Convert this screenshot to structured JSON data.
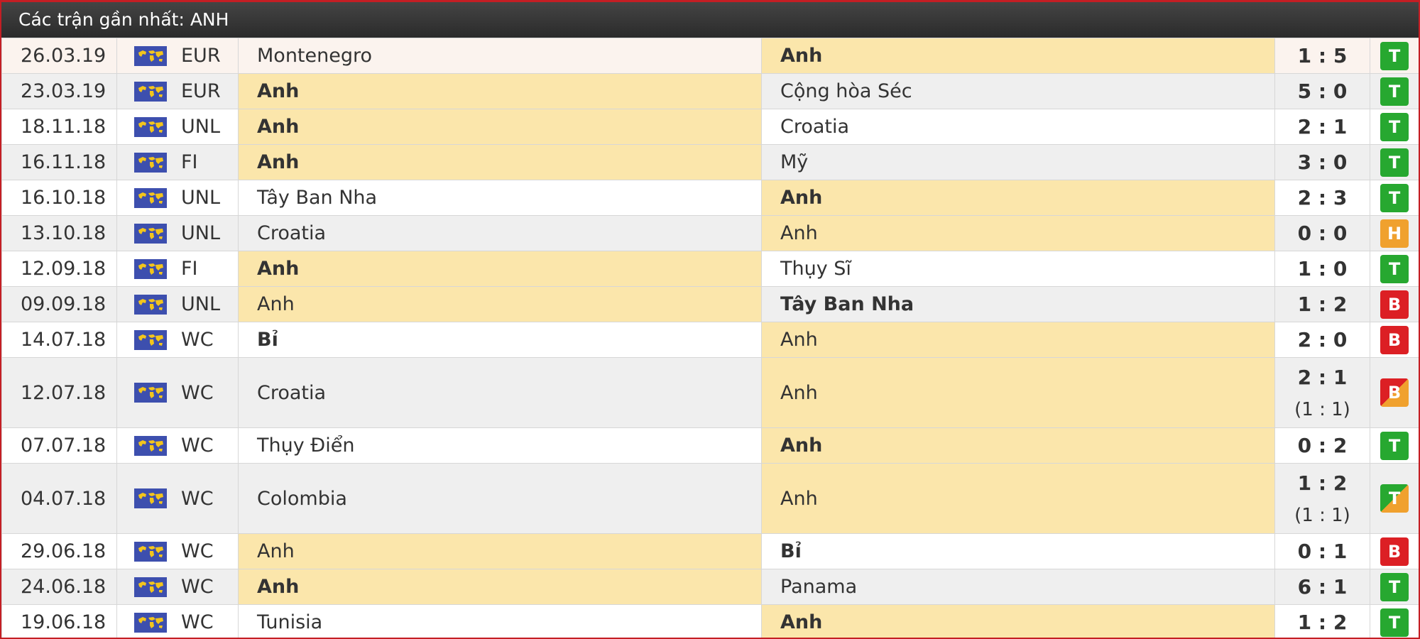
{
  "panel": {
    "title": "Các trận gần nhất: ANH"
  },
  "colors": {
    "header_bg": "#333333",
    "border": "#c41e24",
    "winner_bg": "#fbe6ab",
    "win": "#27a830",
    "draw": "#f0a12e",
    "loss": "#dc1f24"
  },
  "matches": [
    {
      "date": "26.03.19",
      "league": "EUR",
      "home": "Montenegro",
      "away": "Anh",
      "score": "1 : 5",
      "result": "T"
    },
    {
      "date": "23.03.19",
      "league": "EUR",
      "home": "Anh",
      "away": "Cộng hòa Séc",
      "score": "5 : 0",
      "result": "T"
    },
    {
      "date": "18.11.18",
      "league": "UNL",
      "home": "Anh",
      "away": "Croatia",
      "score": "2 : 1",
      "result": "T"
    },
    {
      "date": "16.11.18",
      "league": "FI",
      "home": "Anh",
      "away": "Mỹ",
      "score": "3 : 0",
      "result": "T"
    },
    {
      "date": "16.10.18",
      "league": "UNL",
      "home": "Tây Ban Nha",
      "away": "Anh",
      "score": "2 : 3",
      "result": "T"
    },
    {
      "date": "13.10.18",
      "league": "UNL",
      "home": "Croatia",
      "away": "Anh",
      "score": "0 : 0",
      "result": "H"
    },
    {
      "date": "12.09.18",
      "league": "FI",
      "home": "Anh",
      "away": "Thụy Sĩ",
      "score": "1 : 0",
      "result": "T"
    },
    {
      "date": "09.09.18",
      "league": "UNL",
      "home": "Anh",
      "away": "Tây Ban Nha",
      "score": "1 : 2",
      "result": "B"
    },
    {
      "date": "14.07.18",
      "league": "WC",
      "home": "Bỉ",
      "away": "Anh",
      "score": "2 : 0",
      "result": "B"
    },
    {
      "date": "12.07.18",
      "league": "WC",
      "home": "Croatia",
      "away": "Anh",
      "score": "2 : 1",
      "score_ht": "(1 : 1)",
      "result": "B"
    },
    {
      "date": "07.07.18",
      "league": "WC",
      "home": "Thụy Điển",
      "away": "Anh",
      "score": "0 : 2",
      "result": "T"
    },
    {
      "date": "04.07.18",
      "league": "WC",
      "home": "Colombia",
      "away": "Anh",
      "score": "1 : 2",
      "score_ht": "(1 : 1)",
      "result": "T"
    },
    {
      "date": "29.06.18",
      "league": "WC",
      "home": "Anh",
      "away": "Bỉ",
      "score": "0 : 1",
      "result": "B"
    },
    {
      "date": "24.06.18",
      "league": "WC",
      "home": "Anh",
      "away": "Panama",
      "score": "6 : 1",
      "result": "T"
    },
    {
      "date": "19.06.18",
      "league": "WC",
      "home": "Tunisia",
      "away": "Anh",
      "score": "1 : 2",
      "result": "T"
    }
  ]
}
